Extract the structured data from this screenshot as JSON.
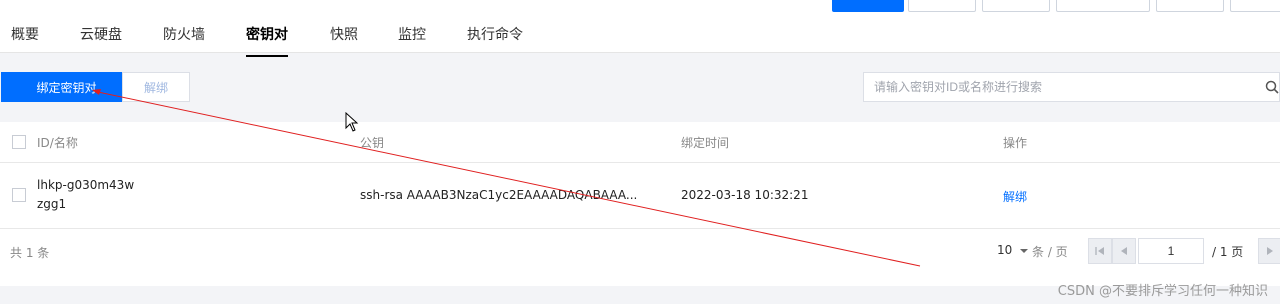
{
  "tabs": [
    {
      "label": "概要"
    },
    {
      "label": "云硬盘"
    },
    {
      "label": "防火墙"
    },
    {
      "label": "密钥对"
    },
    {
      "label": "快照"
    },
    {
      "label": "监控"
    },
    {
      "label": "执行命令"
    }
  ],
  "active_tab": "密钥对",
  "toolbar": {
    "bind_label": "绑定密钥对",
    "unbind_label": "解绑"
  },
  "search": {
    "placeholder": "请输入密钥对ID或名称进行搜索",
    "value": ""
  },
  "table": {
    "headers": [
      "ID/名称",
      "公钥",
      "绑定时间",
      "操作"
    ],
    "rows": [
      {
        "id": "lhkp-g030m43w",
        "name": "zgg1",
        "public_key": "ssh-rsa AAAAB3NzaC1yc2EAAAADAQABAAA...",
        "bind_time": "2022-03-18 10:32:21",
        "action": "解绑"
      }
    ]
  },
  "pagination": {
    "total": "共 1 条",
    "page_size": "10",
    "page_size_unit": "条 / 页",
    "current_page": "1",
    "total_pages": "/ 1 页"
  },
  "watermark": "CSDN @不要排斥学习任何一种知识",
  "colors": {
    "primary": "#006eff",
    "annotation": "#e02020"
  },
  "icons": [
    "search-icon",
    "chevron-down-icon",
    "first-page-icon",
    "prev-page-icon",
    "next-page-icon",
    "mouse-cursor-icon"
  ]
}
